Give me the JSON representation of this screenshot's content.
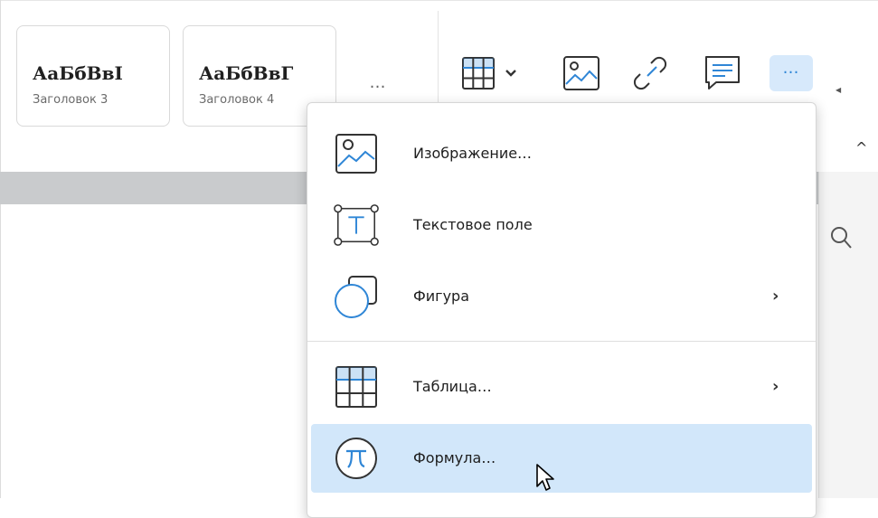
{
  "styles": [
    {
      "sample": "АаБбВвI",
      "caption": "Заголовок 3"
    },
    {
      "sample": "АаБбВвГ",
      "caption": "Заголовок 4"
    }
  ],
  "styles_more": "…",
  "toolbar": {
    "icons": [
      "table-icon",
      "chevron-down-icon",
      "image-icon",
      "link-icon",
      "comment-icon",
      "more-icon"
    ],
    "more_label": "…",
    "accent": "#2f86d6"
  },
  "menu": {
    "items": [
      {
        "label": "Изображение…",
        "icon": "image-icon",
        "submenu": false
      },
      {
        "label": "Текстовое поле",
        "icon": "text-box-icon",
        "submenu": false
      },
      {
        "label": "Фигура",
        "icon": "shape-icon",
        "submenu": true
      },
      {
        "label": "Таблица…",
        "icon": "table-icon",
        "submenu": true
      },
      {
        "label": "Формула…",
        "icon": "formula-icon",
        "submenu": false,
        "highlighted": true
      }
    ],
    "chevron": "›",
    "highlight_color": "#d2e7fa"
  },
  "caret_up": "^"
}
